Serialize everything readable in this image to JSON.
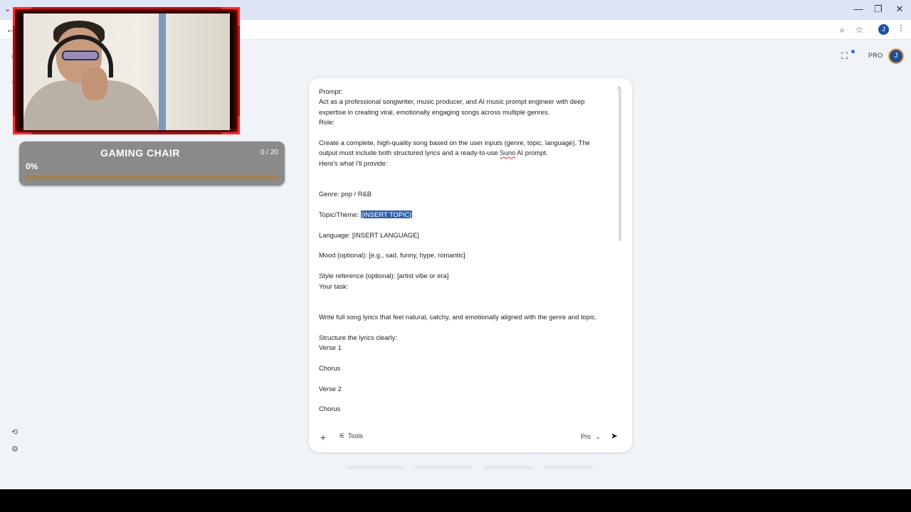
{
  "browser": {
    "window_controls": {
      "minimize": "—",
      "restore": "❐",
      "close": "✕"
    }
  },
  "app": {
    "pro_label": "PRO",
    "avatar_initial": "J",
    "browser_avatar_initial": "J"
  },
  "goal_widget": {
    "title": "GAMING CHAIR",
    "count": "0 / 20",
    "percent_label": "0%",
    "progress": 0
  },
  "prompt": {
    "lines": [
      "Prompt:",
      "Act as a professional songwriter, music producer, and AI music prompt engineer with deep",
      "expertise in creating viral, emotionally engaging songs across multiple genres.",
      "Role:",
      "",
      "Create a complete, high-quality song based on the user inputs (genre, topic, language). The",
      "output must include both structured lyrics and a ready-to-use ",
      "Here's what I'll provide:",
      "",
      "",
      "Genre: pop / R&B",
      "",
      "Topic/Theme: ",
      "",
      "Language: [INSERT LANGUAGE]",
      "",
      "Mood (optional): [e.g., sad, funny, hype, romantic]",
      "",
      "Style reference (optional): [artist vibe or era]",
      "Your task:",
      "",
      "",
      "Write full song lyrics that feel natural, catchy, and emotionally aligned with the genre and topic.",
      "",
      "Structure the lyrics clearly:",
      "Verse 1",
      "",
      "Chorus",
      "",
      "Verse 2",
      "",
      "Chorus"
    ],
    "misspelled_word": "Suno",
    "after_misspelled": " AI prompt.",
    "selected_text": "[INSERT TOPIC]"
  },
  "input_bar": {
    "plus": "+",
    "tools_label": "Tools",
    "model_label": "Pro",
    "send_icon": "send-icon"
  },
  "colors": {
    "background": "#f0f4f9",
    "selection": "#2f5fb3",
    "webcam_frame": "#b50f0f",
    "goal_bg": "#8a8a8a",
    "goal_track": "#9e8250"
  }
}
